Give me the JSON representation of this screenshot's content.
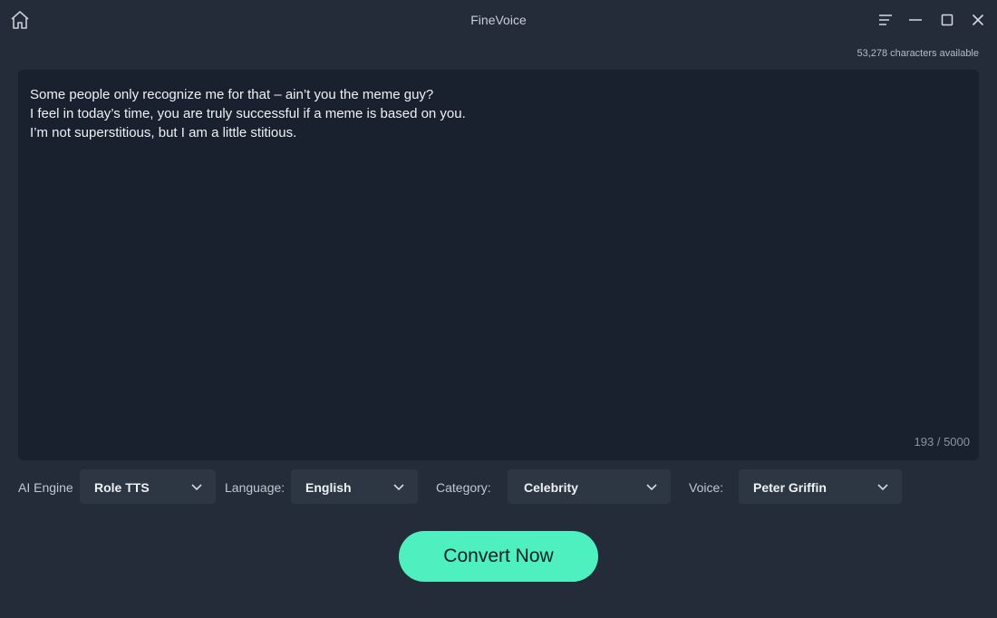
{
  "app": {
    "title": "FineVoice"
  },
  "icons": {
    "home": "home-icon",
    "menu": "menu-icon",
    "minimize": "minimize-icon",
    "maximize": "maximize-icon",
    "close": "close-icon",
    "dropdown": "chevron-down-icon"
  },
  "colors": {
    "background": "#232c38",
    "editor": "#18212d",
    "dropdown": "#2d3643",
    "accent": "#4ef0c0"
  },
  "header": {
    "characters_available": "53,278 characters available"
  },
  "editor": {
    "lines": [
      "Some people only recognize me for that – ain’t you the meme guy?",
      "I feel in today’s time, you are truly successful if a meme is based on you.",
      "I’m not superstitious, but I am a little stitious."
    ],
    "counter": "193 / 5000"
  },
  "controls": {
    "ai_engine": {
      "label": "AI Engine",
      "value": "Role TTS"
    },
    "language": {
      "label": "Language:",
      "value": "English"
    },
    "category": {
      "label": "Category:",
      "value": "Celebrity"
    },
    "voice": {
      "label": "Voice:",
      "value": "Peter Griffin"
    }
  },
  "actions": {
    "convert_label": "Convert Now"
  }
}
